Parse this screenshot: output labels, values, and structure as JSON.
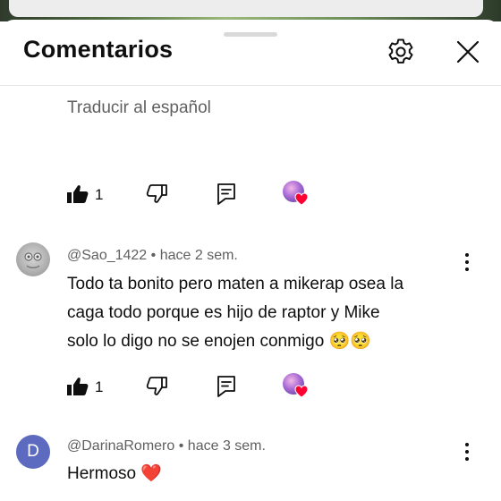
{
  "header": {
    "title": "Comentarios",
    "settings_icon": "gear-icon",
    "close_icon": "close-icon"
  },
  "first_comment_tail": {
    "translate_label": "Traducir al español",
    "likes": "1"
  },
  "comments": [
    {
      "author": "@Sao_1422",
      "separator": "•",
      "time": "hace 2 sem.",
      "lines": [
        "Todo ta bonito pero maten a mikerap osea la",
        "caga todo porque es hijo de raptor y Mike",
        "solo lo digo no se enojen conmigo 🥺🥺"
      ],
      "likes": "1"
    },
    {
      "author": "@DarinaRomero",
      "separator": "•",
      "time": "hace 3 sem.",
      "avatar_letter": "D",
      "lines": [
        "Hermoso ❤️"
      ]
    }
  ],
  "colors": {
    "accent_heart": "#ff0033",
    "avatar_d": "#5c6bc0"
  }
}
